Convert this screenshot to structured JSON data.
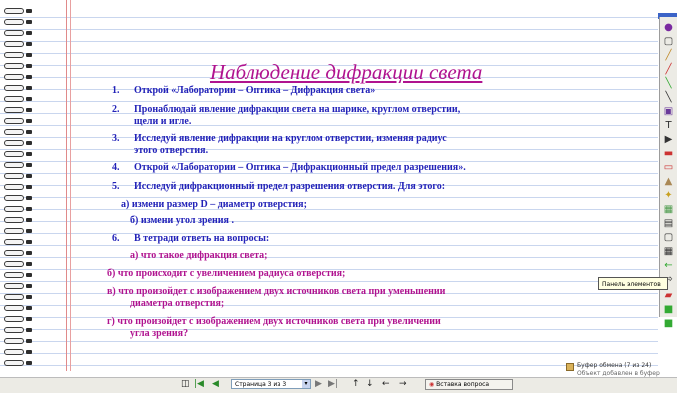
{
  "document": {
    "title": "Наблюдение дифракции света",
    "items": [
      {
        "num": "1.",
        "text": "Открой «Лаборатории – Оптика – Дифракция света»"
      },
      {
        "num": "2.",
        "text": "Пронаблюдай явление дифракции света на шарике, круглом отверстии,",
        "text2": "щели и игле."
      },
      {
        "num": "3.",
        "text": "Исследуй явление дифракции на круглом отверстии, изменяя радиус",
        "text2": "этого отверстия."
      },
      {
        "num": "4.",
        "text": "Открой «Лаборатории – Оптика – Дифракционный предел разрешения»."
      },
      {
        "num": "5.",
        "text": "Исследуй дифракционный предел разрешения отверстия. Для этого:"
      }
    ],
    "sub_a": "а) измени размер D – диаметр отверстия;",
    "sub_b": "б) измени угол зрения .",
    "item6_num": "6.",
    "item6_text": "В тетради ответь на вопросы:",
    "q_a": "а) что такое дифракция света;",
    "q_b": "б) что происходит с увеличением радиуса отверстия;",
    "q_c1": "в) что произойдет с изображением двух источников света при уменьшении",
    "q_c2": "диаметра отверстия;",
    "q_d1": "г) что произойдет с изображением двух источников света при увеличении",
    "q_d2": "угла зрения?"
  },
  "tooltip": "Панель элементов",
  "clipboard": {
    "title": "Буфер обмена (7 из 24)",
    "subtitle": "Объект добавлен в буфер"
  },
  "bottom": {
    "page_select": "Страница 3 из 3",
    "insert_label": "Вставка вопроса"
  },
  "colors": {
    "title": "#b0138f",
    "blue": "#2222b8",
    "purple": "#b0138f"
  }
}
